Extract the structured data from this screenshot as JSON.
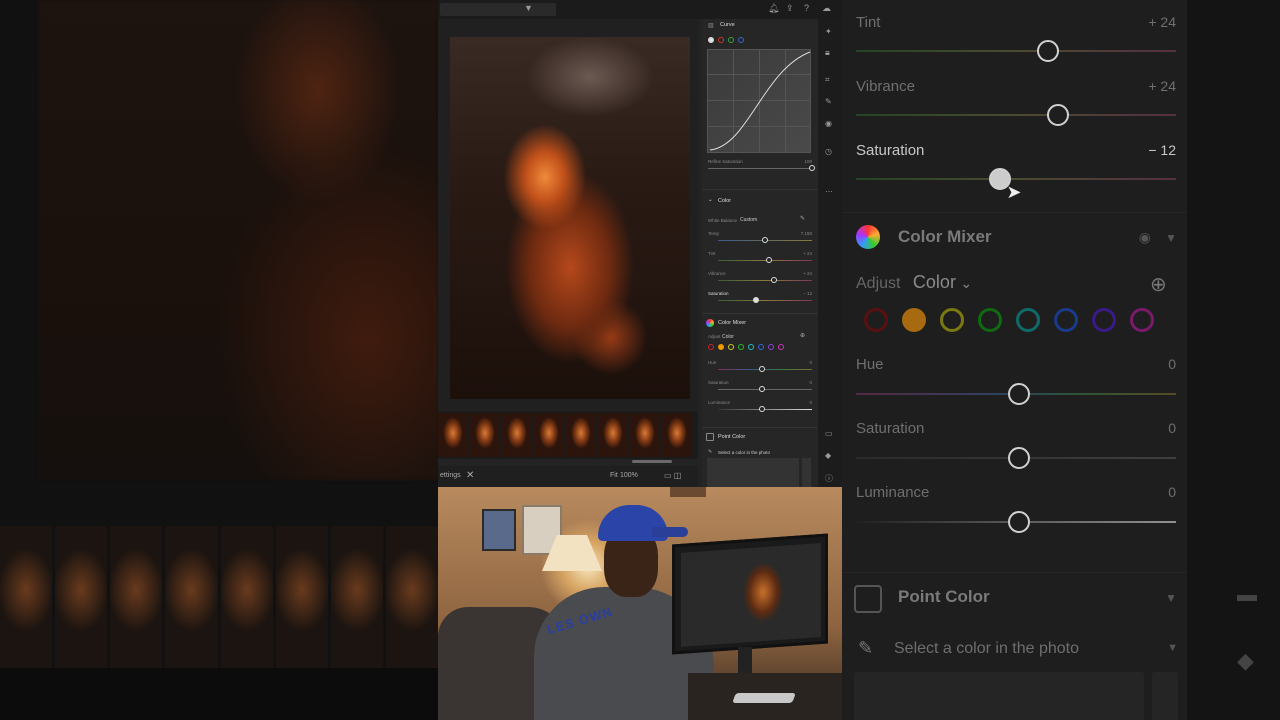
{
  "colors": {
    "panel_bg": "#262626",
    "accent_white": "#dddddd",
    "orange_dot": "#f0a030"
  },
  "zoom_panel": {
    "rows": [
      {
        "label": "Tint",
        "value": "+ 24"
      },
      {
        "label": "Vibrance",
        "value": "+ 24"
      },
      {
        "label": "Saturation",
        "value": "− 12"
      }
    ],
    "color_mixer_title": "Color Mixer",
    "adjust_label": "Adjust",
    "adjust_value": "Color",
    "mixer_rows": [
      {
        "label": "Hue",
        "value": "0"
      },
      {
        "label": "Saturation",
        "value": "0"
      },
      {
        "label": "Luminance",
        "value": "0"
      }
    ],
    "point_color_title": "Point Color",
    "select_color_text": "Select a color in the photo"
  },
  "lightroom": {
    "curve": {
      "title": "Curve",
      "refine_label": "Refine Saturation",
      "refine_value": "100"
    },
    "color": {
      "title": "Color",
      "white_balance_label": "White Balance",
      "white_balance_value": "Custom",
      "rows": [
        {
          "label": "Temp",
          "value": "7,150"
        },
        {
          "label": "Tint",
          "value": "+ 24"
        },
        {
          "label": "Vibrance",
          "value": "+ 24"
        },
        {
          "label": "Saturation",
          "value": "− 12"
        }
      ]
    },
    "color_mixer": {
      "title": "Color Mixer",
      "adjust_label": "Adjust",
      "adjust_value": "Color",
      "rows": [
        {
          "label": "Hue",
          "value": "0"
        },
        {
          "label": "Saturation",
          "value": "0"
        },
        {
          "label": "Luminance",
          "value": "0"
        }
      ]
    },
    "point_color": {
      "title": "Point Color",
      "select_text": "Select a color in the photo"
    },
    "bottom_bar": {
      "settings_label": "ettings",
      "fit_label": "Fit",
      "zoom_value": "100%"
    }
  },
  "video": {
    "shirt_text": "LES OWN"
  }
}
